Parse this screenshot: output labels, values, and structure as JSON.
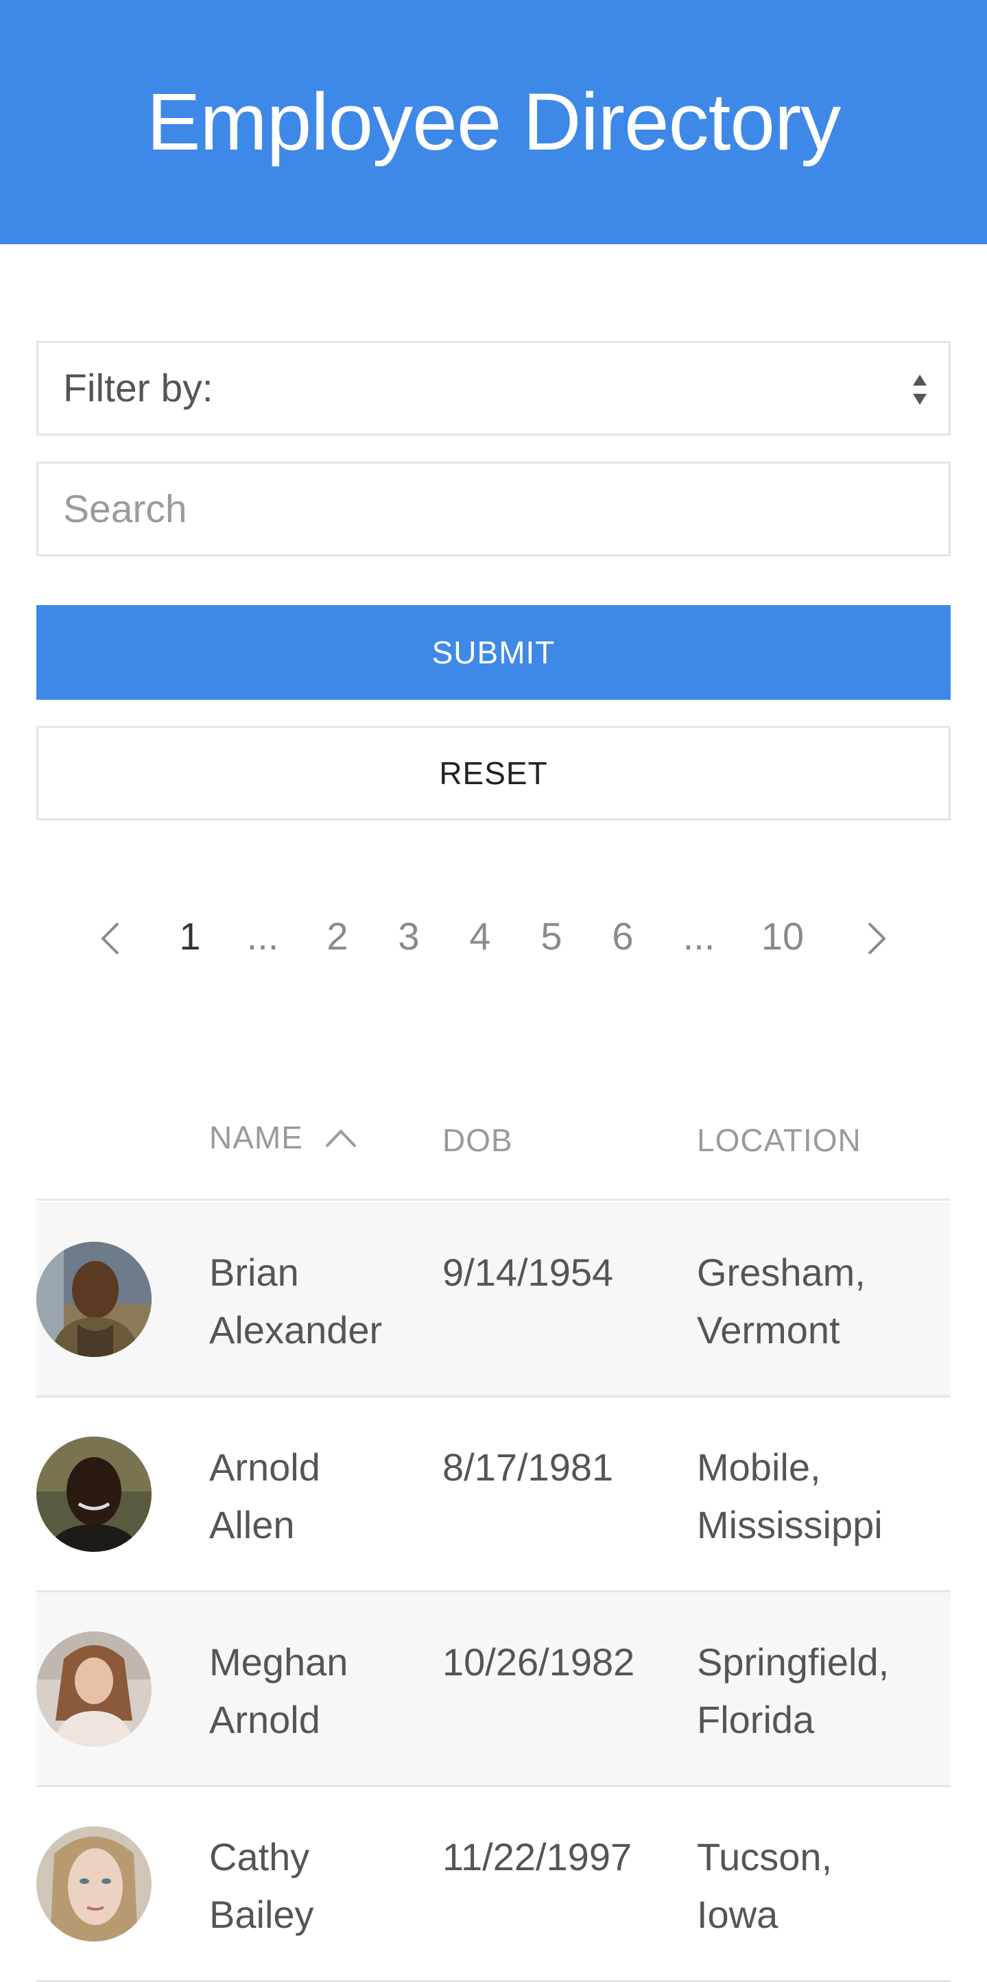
{
  "header": {
    "title": "Employee Directory"
  },
  "filter": {
    "label": "Filter by:"
  },
  "search": {
    "placeholder": "Search"
  },
  "buttons": {
    "submit": "SUBMIT",
    "reset": "RESET"
  },
  "pagination": {
    "items": [
      "1",
      "...",
      "2",
      "3",
      "4",
      "5",
      "6",
      "...",
      "10"
    ],
    "active": "1"
  },
  "table": {
    "columns": {
      "name": "NAME",
      "dob": "DOB",
      "location": "LOCATION"
    },
    "sort": "name-ascending",
    "rows": [
      {
        "first": "Brian",
        "last": "Alexander",
        "dob": "9/14/1954",
        "city": "Gresham,",
        "state": "Vermont"
      },
      {
        "first": "Arnold",
        "last": "Allen",
        "dob": "8/17/1981",
        "city": "Mobile,",
        "state": "Mississippi"
      },
      {
        "first": "Meghan",
        "last": "Arnold",
        "dob": "10/26/1982",
        "city": "Springfield,",
        "state": "Florida"
      },
      {
        "first": "Cathy",
        "last": "Bailey",
        "dob": "11/22/1997",
        "city": "Tucson,",
        "state": "Iowa"
      }
    ]
  },
  "colors": {
    "primary": "#3e88e8",
    "border": "#e5e5e5",
    "row_alt": "#f7f7f7"
  }
}
